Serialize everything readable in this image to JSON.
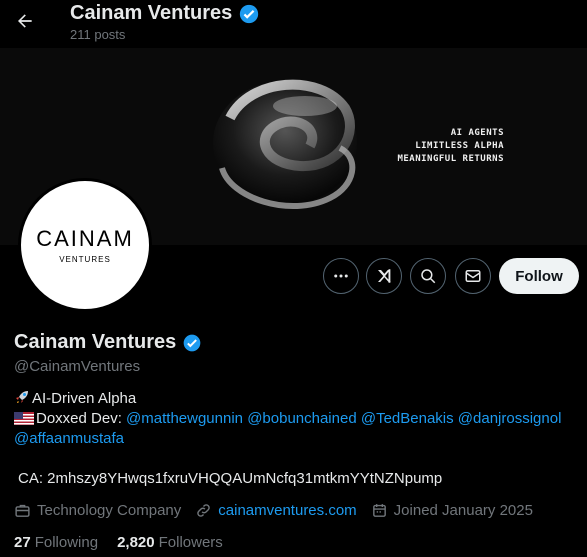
{
  "header": {
    "title": "Cainam Ventures",
    "post_count": "211 posts"
  },
  "banner": {
    "lines": [
      "AI AGENTS",
      "LIMITLESS ALPHA",
      "MEANINGFUL RETURNS"
    ]
  },
  "avatar": {
    "logo_text": "CAINAM",
    "logo_sub": "VENTURES"
  },
  "actions": {
    "follow_label": "Follow",
    "icons": [
      "more-icon",
      "grok-icon",
      "search-icon",
      "message-icon"
    ]
  },
  "profile": {
    "name": "Cainam Ventures",
    "handle": "@CainamVentures",
    "verified": true,
    "bio_line1": "AI-Driven Alpha",
    "bio_line2_prefix": "Doxxed Dev: ",
    "mentions": [
      "@matthewgunnin",
      "@bobunchained",
      "@TedBenakis",
      "@danjrossignol",
      "@affaanmustafa"
    ],
    "ca": "CA: 2mhszy8YHwqs1fxruVHQQAUmNcfq31mtkmYYtNZNpump"
  },
  "meta": {
    "category": "Technology Company",
    "website": "cainamventures.com",
    "joined": "Joined January 2025"
  },
  "stats": {
    "following_count": "27",
    "following_label": "Following",
    "followers_count": "2,820",
    "followers_label": "Followers"
  },
  "colors": {
    "accent": "#1d9bf0",
    "muted": "#71767b",
    "text": "#e7e9ea",
    "background": "#000000"
  }
}
